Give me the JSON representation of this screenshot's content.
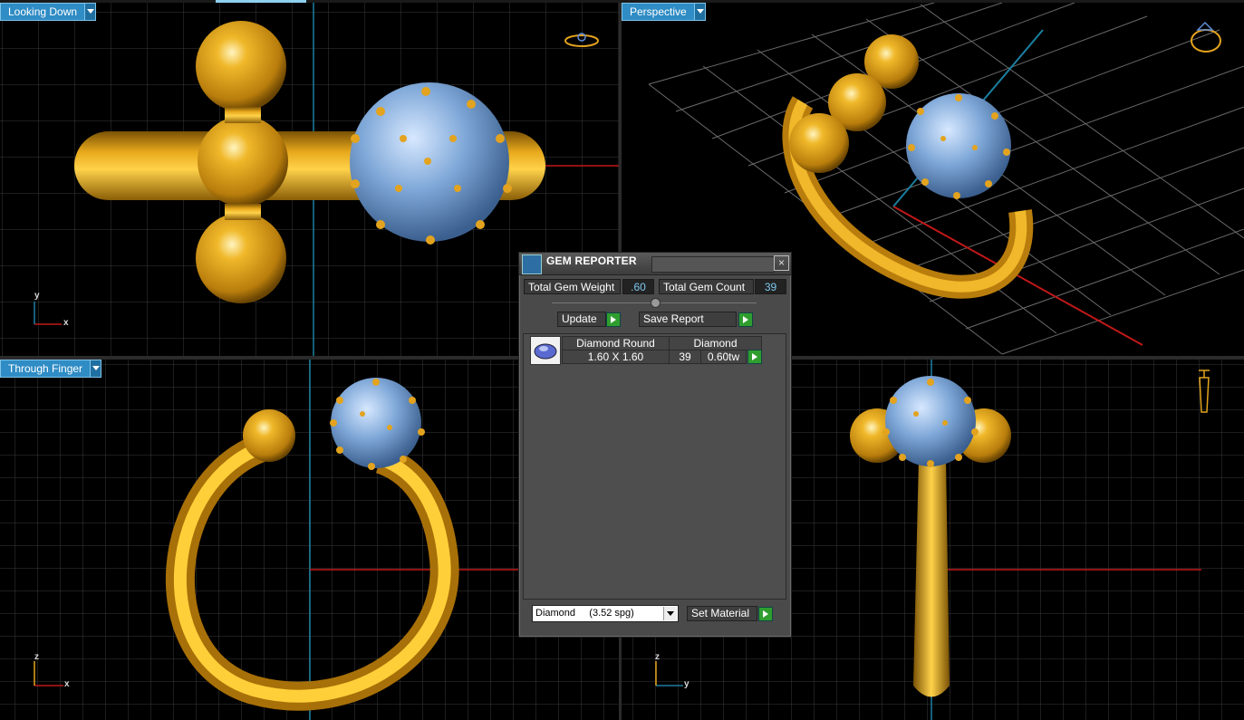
{
  "viewports": {
    "top_left": {
      "label": "Looking Down",
      "axis_a": "y",
      "axis_b": "x"
    },
    "top_right": {
      "label": "Perspective"
    },
    "bottom_left": {
      "label": "Through Finger",
      "axis_a": "z",
      "axis_b": "x"
    },
    "bottom_right": {
      "axis_a": "z",
      "axis_b": "y"
    }
  },
  "colors": {
    "gold": "#e0a21a",
    "gem": "#7fa8d8",
    "grid": "#3a3a3a",
    "axis_red": "#c01818",
    "axis_blue": "#1a7fa0",
    "label_bg": "#2f8cc4"
  },
  "gem_reporter": {
    "title": "GEM REPORTER",
    "close": "×",
    "total_weight_label": "Total Gem Weight",
    "total_weight_value": ".60",
    "total_count_label": "Total Gem Count",
    "total_count_value": "39",
    "update_label": "Update",
    "save_report_label": "Save Report",
    "row": {
      "shape_header": "Diamond Round",
      "material_header": "Diamond",
      "size": "1.60 X 1.60",
      "count": "39",
      "weight": "0.60tw"
    },
    "material_select": "Diamond     (3.52 spg)",
    "set_material_label": "Set Material"
  }
}
